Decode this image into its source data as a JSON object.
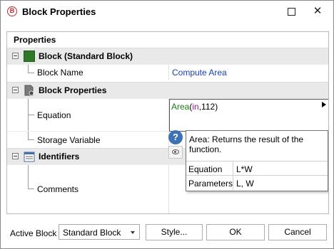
{
  "window": {
    "title": "Block Properties",
    "app_icon_letter": "B",
    "minimize_label": "",
    "close_label": "✕"
  },
  "panel": {
    "header": "Properties",
    "categories": [
      {
        "label": "Block (Standard Block)",
        "icon": "block-icon",
        "rows": [
          {
            "label": "Block Name",
            "value": "Compute Area"
          }
        ]
      },
      {
        "label": "Block Properties",
        "icon": "document-gear-icon",
        "rows": [
          {
            "label": "Equation",
            "value": ""
          },
          {
            "label": "Storage Variable",
            "value": ""
          }
        ]
      },
      {
        "label": "Identifiers",
        "icon": "calendar-list-icon",
        "rows": [
          {
            "label": "Comments",
            "value": ""
          }
        ]
      }
    ]
  },
  "equation": {
    "function": "Area",
    "open": "(",
    "arg1": "in",
    "sep": ",",
    "arg2": "112",
    "close": ")"
  },
  "tooltip": {
    "description": "Area: Returns the result of the function.",
    "rows": [
      {
        "key": "Equation",
        "value": "L*W"
      },
      {
        "key": "Parameters",
        "value": "L, W"
      }
    ]
  },
  "footer": {
    "active_block_label": "Active Block",
    "active_block_value": "Standard Block",
    "style_button": "Style...",
    "ok_button": "OK",
    "cancel_button": "Cancel"
  },
  "colors": {
    "value_text": "#1a3db5",
    "category_bg": "#e9e9e9",
    "help_button": "#3c73b5",
    "function_name": "#1b7a1b",
    "argument": "#8a2090"
  }
}
